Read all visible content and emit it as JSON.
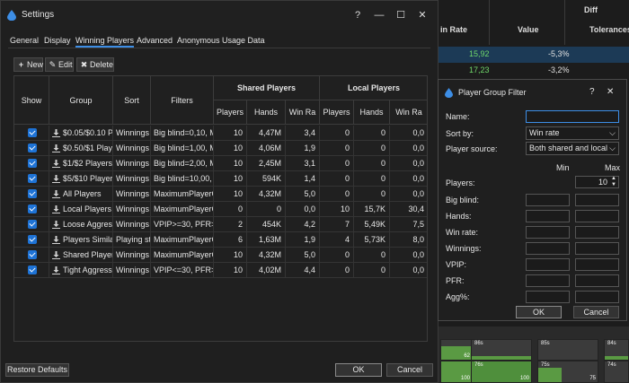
{
  "background": {
    "top_label": "Diff",
    "columns": [
      "in Rate",
      "Value",
      "Tolerances"
    ],
    "rows": [
      {
        "win_rate": "15,92",
        "value": "-5,3%"
      },
      {
        "win_rate": "17,23",
        "value": "-3,2%"
      }
    ],
    "grid_cells": [
      {
        "label": "",
        "num": "62"
      },
      {
        "label": "86s",
        "num": ""
      },
      {
        "label": "85s",
        "num": ""
      },
      {
        "label": "84s",
        "num": ""
      },
      {
        "label": "",
        "num": "100"
      },
      {
        "label": "76s",
        "num": "100"
      },
      {
        "label": "75s",
        "num": "75"
      },
      {
        "label": "74s",
        "num": ""
      }
    ],
    "colors": {
      "positive": "#6fd86a",
      "negative": "#e0e0e0",
      "selected_row": "#1c3a56"
    }
  },
  "settings": {
    "title": "Settings",
    "title_buttons": [
      "?",
      "—",
      "☐",
      "✕"
    ],
    "tabs": [
      "General",
      "Display",
      "Winning Players",
      "Advanced",
      "Anonymous Usage Data"
    ],
    "active_tab": 2,
    "toolbar": {
      "new": "New",
      "edit": "Edit",
      "delete": "Delete"
    },
    "grid": {
      "headers": {
        "show": "Show",
        "group": "Group",
        "sort": "Sort",
        "filters": "Filters",
        "shared": "Shared Players",
        "local": "Local Players",
        "players": "Players",
        "hands": "Hands",
        "win_rate": "Win Ra"
      },
      "rows": [
        {
          "group": "$0.05/$0.10 Pla",
          "sort": "Winnings",
          "filters": "Big blind=0,10, Ma",
          "sp": "10",
          "sh": "4,47M",
          "sw": "3,4",
          "lp": "0",
          "lh": "0",
          "lw": "0,0"
        },
        {
          "group": "$0.50/$1 Playe",
          "sort": "Winnings",
          "filters": "Big blind=1,00, Ma",
          "sp": "10",
          "sh": "4,06M",
          "sw": "1,9",
          "lp": "0",
          "lh": "0",
          "lw": "0,0"
        },
        {
          "group": "$1/$2 Players",
          "sort": "Winnings",
          "filters": "Big blind=2,00, Ma",
          "sp": "10",
          "sh": "2,45M",
          "sw": "3,1",
          "lp": "0",
          "lh": "0",
          "lw": "0,0"
        },
        {
          "group": "$5/$10 Players",
          "sort": "Winnings",
          "filters": "Big blind=10,00, M",
          "sp": "10",
          "sh": "594K",
          "sw": "1,4",
          "lp": "0",
          "lh": "0",
          "lw": "0,0"
        },
        {
          "group": "All Players",
          "sort": "Winnings",
          "filters": "MaximumPlayerCo",
          "sp": "10",
          "sh": "4,32M",
          "sw": "5,0",
          "lp": "0",
          "lh": "0",
          "lw": "0,0"
        },
        {
          "group": "Local Players",
          "sort": "Winnings",
          "filters": "MaximumPlayerCo",
          "sp": "0",
          "sh": "0",
          "sw": "0,0",
          "lp": "10",
          "lh": "15,7K",
          "lw": "30,4"
        },
        {
          "group": "Loose Aggressi",
          "sort": "Winnings",
          "filters": "VPIP>=30, PFR>=",
          "sp": "2",
          "sh": "454K",
          "sw": "4,2",
          "lp": "7",
          "lh": "5,49K",
          "lw": "7,5"
        },
        {
          "group": "Players Similar",
          "sort": "Playing st",
          "filters": "MaximumPlayerCo",
          "sp": "6",
          "sh": "1,63M",
          "sw": "1,9",
          "lp": "4",
          "lh": "5,73K",
          "lw": "8,0"
        },
        {
          "group": "Shared Players",
          "sort": "Winnings",
          "filters": "MaximumPlayerCo",
          "sp": "10",
          "sh": "4,32M",
          "sw": "5,0",
          "lp": "0",
          "lh": "0",
          "lw": "0,0"
        },
        {
          "group": "Tight Aggressi",
          "sort": "Winnings",
          "filters": "VPIP<=30, PFR>=",
          "sp": "10",
          "sh": "4,02M",
          "sw": "4,4",
          "lp": "0",
          "lh": "0",
          "lw": "0,0"
        }
      ]
    },
    "restore": "Restore Defaults",
    "ok": "OK",
    "cancel": "Cancel"
  },
  "filter_dialog": {
    "title": "Player Group Filter",
    "help": "?",
    "close": "✕",
    "name_label": "Name:",
    "name_value": "",
    "sort_label": "Sort by:",
    "sort_value": "Win rate",
    "source_label": "Player source:",
    "source_value": "Both shared and local",
    "min_label": "Min",
    "max_label": "Max",
    "players_label": "Players:",
    "players_max": "10",
    "range_labels": [
      "Big blind:",
      "Hands:",
      "Win rate:",
      "Winnings:",
      "VPIP:",
      "PFR:",
      "Agg%:"
    ],
    "ok": "OK",
    "cancel": "Cancel"
  }
}
